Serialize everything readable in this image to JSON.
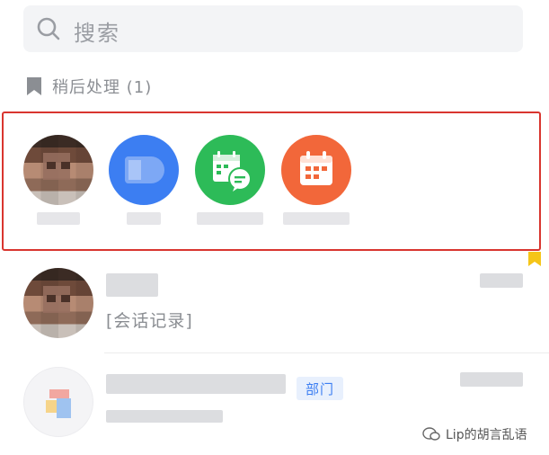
{
  "search": {
    "placeholder": "搜索"
  },
  "later_section": {
    "title": "稍后处理 (1)"
  },
  "quick_items": [
    {
      "icon": "person-avatar"
    },
    {
      "icon": "chat-app-icon",
      "color": "#3c7ef2"
    },
    {
      "icon": "calendar-chat-icon",
      "color": "#2dbb58"
    },
    {
      "icon": "calendar-icon",
      "color": "#f2673a"
    }
  ],
  "conversations": [
    {
      "preview": "[会话记录]",
      "icon": "person-avatar"
    },
    {
      "badge": "部门",
      "icon": "group-avatar"
    }
  ],
  "highlight_color": "#d9352f",
  "pin_color": "#f5c518",
  "watermark": {
    "text": "Lip的胡言乱语"
  }
}
